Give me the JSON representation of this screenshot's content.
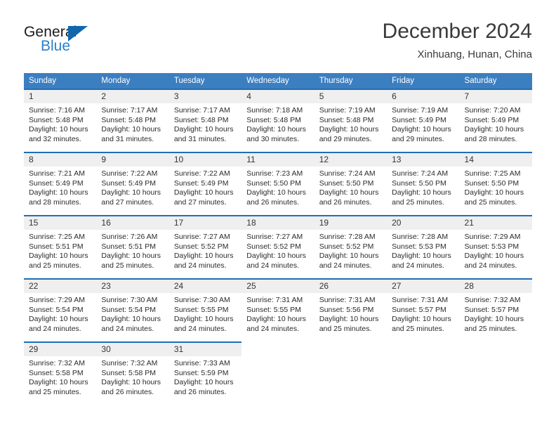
{
  "brand": {
    "name_part1": "General",
    "name_part2": "Blue",
    "accent_color": "#2a7fc9",
    "triangle_color": "#1166ad"
  },
  "header": {
    "title": "December 2024",
    "subtitle": "Xinhuang, Hunan, China"
  },
  "calendar": {
    "header_bg": "#3c7fc1",
    "row_border_color": "#1f6eb5",
    "daynum_bg": "#efefef",
    "weekday_headers": [
      "Sunday",
      "Monday",
      "Tuesday",
      "Wednesday",
      "Thursday",
      "Friday",
      "Saturday"
    ],
    "weeks": [
      [
        {
          "day": "1",
          "sunrise": "Sunrise: 7:16 AM",
          "sunset": "Sunset: 5:48 PM",
          "daylight_line1": "Daylight: 10 hours",
          "daylight_line2": "and 32 minutes."
        },
        {
          "day": "2",
          "sunrise": "Sunrise: 7:17 AM",
          "sunset": "Sunset: 5:48 PM",
          "daylight_line1": "Daylight: 10 hours",
          "daylight_line2": "and 31 minutes."
        },
        {
          "day": "3",
          "sunrise": "Sunrise: 7:17 AM",
          "sunset": "Sunset: 5:48 PM",
          "daylight_line1": "Daylight: 10 hours",
          "daylight_line2": "and 31 minutes."
        },
        {
          "day": "4",
          "sunrise": "Sunrise: 7:18 AM",
          "sunset": "Sunset: 5:48 PM",
          "daylight_line1": "Daylight: 10 hours",
          "daylight_line2": "and 30 minutes."
        },
        {
          "day": "5",
          "sunrise": "Sunrise: 7:19 AM",
          "sunset": "Sunset: 5:48 PM",
          "daylight_line1": "Daylight: 10 hours",
          "daylight_line2": "and 29 minutes."
        },
        {
          "day": "6",
          "sunrise": "Sunrise: 7:19 AM",
          "sunset": "Sunset: 5:49 PM",
          "daylight_line1": "Daylight: 10 hours",
          "daylight_line2": "and 29 minutes."
        },
        {
          "day": "7",
          "sunrise": "Sunrise: 7:20 AM",
          "sunset": "Sunset: 5:49 PM",
          "daylight_line1": "Daylight: 10 hours",
          "daylight_line2": "and 28 minutes."
        }
      ],
      [
        {
          "day": "8",
          "sunrise": "Sunrise: 7:21 AM",
          "sunset": "Sunset: 5:49 PM",
          "daylight_line1": "Daylight: 10 hours",
          "daylight_line2": "and 28 minutes."
        },
        {
          "day": "9",
          "sunrise": "Sunrise: 7:22 AM",
          "sunset": "Sunset: 5:49 PM",
          "daylight_line1": "Daylight: 10 hours",
          "daylight_line2": "and 27 minutes."
        },
        {
          "day": "10",
          "sunrise": "Sunrise: 7:22 AM",
          "sunset": "Sunset: 5:49 PM",
          "daylight_line1": "Daylight: 10 hours",
          "daylight_line2": "and 27 minutes."
        },
        {
          "day": "11",
          "sunrise": "Sunrise: 7:23 AM",
          "sunset": "Sunset: 5:50 PM",
          "daylight_line1": "Daylight: 10 hours",
          "daylight_line2": "and 26 minutes."
        },
        {
          "day": "12",
          "sunrise": "Sunrise: 7:24 AM",
          "sunset": "Sunset: 5:50 PM",
          "daylight_line1": "Daylight: 10 hours",
          "daylight_line2": "and 26 minutes."
        },
        {
          "day": "13",
          "sunrise": "Sunrise: 7:24 AM",
          "sunset": "Sunset: 5:50 PM",
          "daylight_line1": "Daylight: 10 hours",
          "daylight_line2": "and 25 minutes."
        },
        {
          "day": "14",
          "sunrise": "Sunrise: 7:25 AM",
          "sunset": "Sunset: 5:50 PM",
          "daylight_line1": "Daylight: 10 hours",
          "daylight_line2": "and 25 minutes."
        }
      ],
      [
        {
          "day": "15",
          "sunrise": "Sunrise: 7:25 AM",
          "sunset": "Sunset: 5:51 PM",
          "daylight_line1": "Daylight: 10 hours",
          "daylight_line2": "and 25 minutes."
        },
        {
          "day": "16",
          "sunrise": "Sunrise: 7:26 AM",
          "sunset": "Sunset: 5:51 PM",
          "daylight_line1": "Daylight: 10 hours",
          "daylight_line2": "and 25 minutes."
        },
        {
          "day": "17",
          "sunrise": "Sunrise: 7:27 AM",
          "sunset": "Sunset: 5:52 PM",
          "daylight_line1": "Daylight: 10 hours",
          "daylight_line2": "and 24 minutes."
        },
        {
          "day": "18",
          "sunrise": "Sunrise: 7:27 AM",
          "sunset": "Sunset: 5:52 PM",
          "daylight_line1": "Daylight: 10 hours",
          "daylight_line2": "and 24 minutes."
        },
        {
          "day": "19",
          "sunrise": "Sunrise: 7:28 AM",
          "sunset": "Sunset: 5:52 PM",
          "daylight_line1": "Daylight: 10 hours",
          "daylight_line2": "and 24 minutes."
        },
        {
          "day": "20",
          "sunrise": "Sunrise: 7:28 AM",
          "sunset": "Sunset: 5:53 PM",
          "daylight_line1": "Daylight: 10 hours",
          "daylight_line2": "and 24 minutes."
        },
        {
          "day": "21",
          "sunrise": "Sunrise: 7:29 AM",
          "sunset": "Sunset: 5:53 PM",
          "daylight_line1": "Daylight: 10 hours",
          "daylight_line2": "and 24 minutes."
        }
      ],
      [
        {
          "day": "22",
          "sunrise": "Sunrise: 7:29 AM",
          "sunset": "Sunset: 5:54 PM",
          "daylight_line1": "Daylight: 10 hours",
          "daylight_line2": "and 24 minutes."
        },
        {
          "day": "23",
          "sunrise": "Sunrise: 7:30 AM",
          "sunset": "Sunset: 5:54 PM",
          "daylight_line1": "Daylight: 10 hours",
          "daylight_line2": "and 24 minutes."
        },
        {
          "day": "24",
          "sunrise": "Sunrise: 7:30 AM",
          "sunset": "Sunset: 5:55 PM",
          "daylight_line1": "Daylight: 10 hours",
          "daylight_line2": "and 24 minutes."
        },
        {
          "day": "25",
          "sunrise": "Sunrise: 7:31 AM",
          "sunset": "Sunset: 5:55 PM",
          "daylight_line1": "Daylight: 10 hours",
          "daylight_line2": "and 24 minutes."
        },
        {
          "day": "26",
          "sunrise": "Sunrise: 7:31 AM",
          "sunset": "Sunset: 5:56 PM",
          "daylight_line1": "Daylight: 10 hours",
          "daylight_line2": "and 25 minutes."
        },
        {
          "day": "27",
          "sunrise": "Sunrise: 7:31 AM",
          "sunset": "Sunset: 5:57 PM",
          "daylight_line1": "Daylight: 10 hours",
          "daylight_line2": "and 25 minutes."
        },
        {
          "day": "28",
          "sunrise": "Sunrise: 7:32 AM",
          "sunset": "Sunset: 5:57 PM",
          "daylight_line1": "Daylight: 10 hours",
          "daylight_line2": "and 25 minutes."
        }
      ],
      [
        {
          "day": "29",
          "sunrise": "Sunrise: 7:32 AM",
          "sunset": "Sunset: 5:58 PM",
          "daylight_line1": "Daylight: 10 hours",
          "daylight_line2": "and 25 minutes."
        },
        {
          "day": "30",
          "sunrise": "Sunrise: 7:32 AM",
          "sunset": "Sunset: 5:58 PM",
          "daylight_line1": "Daylight: 10 hours",
          "daylight_line2": "and 26 minutes."
        },
        {
          "day": "31",
          "sunrise": "Sunrise: 7:33 AM",
          "sunset": "Sunset: 5:59 PM",
          "daylight_line1": "Daylight: 10 hours",
          "daylight_line2": "and 26 minutes."
        },
        {
          "day": "",
          "sunrise": "",
          "sunset": "",
          "daylight_line1": "",
          "daylight_line2": ""
        },
        {
          "day": "",
          "sunrise": "",
          "sunset": "",
          "daylight_line1": "",
          "daylight_line2": ""
        },
        {
          "day": "",
          "sunrise": "",
          "sunset": "",
          "daylight_line1": "",
          "daylight_line2": ""
        },
        {
          "day": "",
          "sunrise": "",
          "sunset": "",
          "daylight_line1": "",
          "daylight_line2": ""
        }
      ]
    ]
  }
}
